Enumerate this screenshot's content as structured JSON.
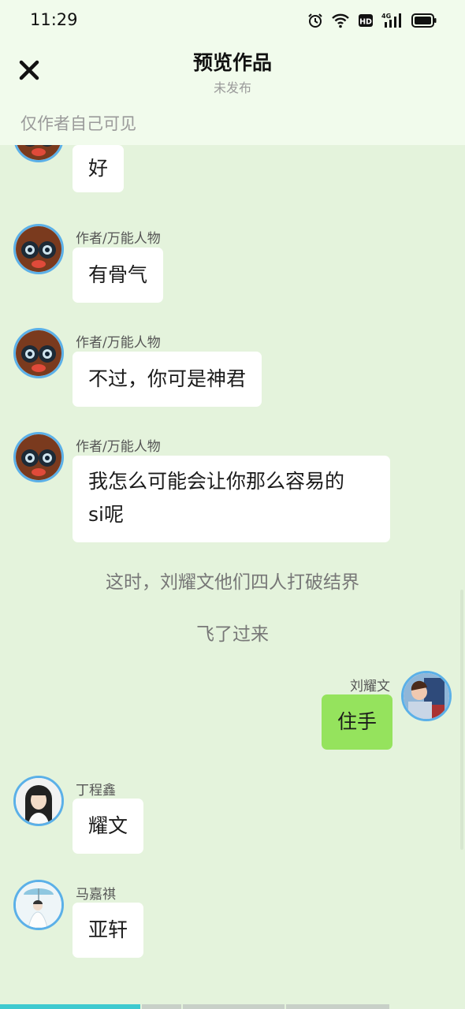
{
  "status_bar": {
    "time": "11:29",
    "network": "4G",
    "hd": "HD"
  },
  "header": {
    "title": "预览作品",
    "subtitle": "未发布",
    "close_icon": "close-icon"
  },
  "visibility_note": "仅作者自己可见",
  "messages": [
    {
      "type": "left",
      "name": "",
      "text": "好"
    },
    {
      "type": "left",
      "name": "作者/万能人物",
      "text": "有骨气"
    },
    {
      "type": "left",
      "name": "作者/万能人物",
      "text": "不过，你可是神君"
    },
    {
      "type": "left",
      "name": "作者/万能人物",
      "line1": "我怎么可能会让你那么容易的",
      "line2": "si呢"
    },
    {
      "type": "narration",
      "text": "这时，刘耀文他们四人打破结界"
    },
    {
      "type": "narration",
      "text": "飞了过来"
    },
    {
      "type": "right",
      "name": "刘耀文",
      "text": "住手"
    },
    {
      "type": "left",
      "name": "丁程鑫",
      "text": "耀文"
    },
    {
      "type": "left",
      "name": "马嘉祺",
      "text": "亚轩"
    }
  ],
  "colors": {
    "background": "#e4f3dc",
    "header_bg": "#f1fbec",
    "bubble_left": "#ffffff",
    "bubble_right": "#95e35d",
    "avatar_border": "#5bb0e8",
    "progress_active": "#3ec9cf"
  },
  "playback_progress": 0.3
}
